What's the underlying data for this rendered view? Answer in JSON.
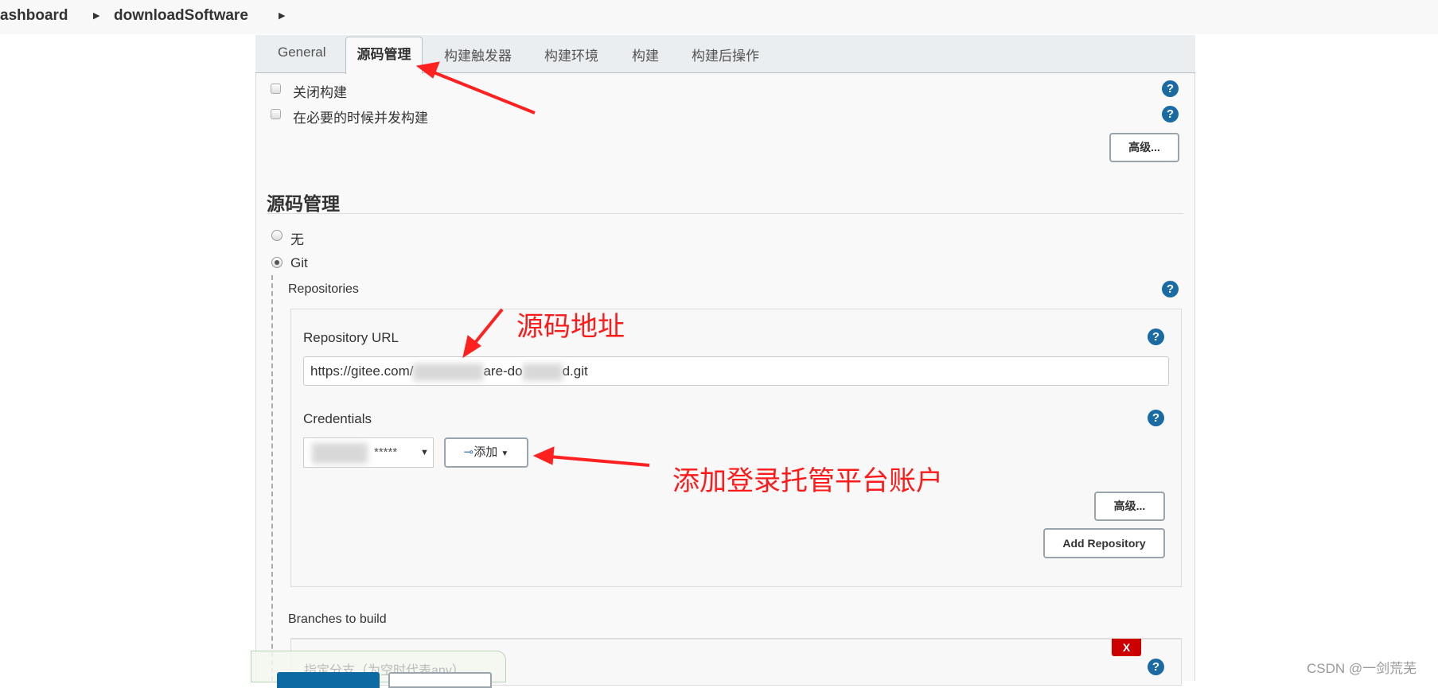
{
  "breadcrumb": {
    "items": [
      "ashboard",
      "downloadSoftware"
    ]
  },
  "tabs": [
    "General",
    "源码管理",
    "构建触发器",
    "构建环境",
    "构建",
    "构建后操作"
  ],
  "active_tab": "源码管理",
  "general": {
    "options": [
      "关闭构建",
      "在必要的时候并发构建"
    ],
    "advanced_label": "高级..."
  },
  "scm": {
    "title": "源码管理",
    "options": [
      {
        "label": "无",
        "selected": false
      },
      {
        "label": "Git",
        "selected": true
      }
    ],
    "repositories_label": "Repositories",
    "repo_url_label": "Repository URL",
    "repo_url_parts": [
      "https://gitee.com/",
      "are-do",
      "d.git"
    ],
    "credentials_label": "Credentials",
    "credentials_value": "*****",
    "add_label": "添加",
    "advanced_label": "高级...",
    "add_repository_label": "Add Repository",
    "branches_label": "Branches to build",
    "branch_placeholder": "指定分支（为空时代表any）",
    "delete_label": "X"
  },
  "annotations": {
    "repo_url": "源码地址",
    "credentials": "添加登录托管平台账户"
  },
  "watermark": "CSDN @一剑荒芜",
  "colors": {
    "accent": "#1a6aa3",
    "annotation": "#ff1a1a",
    "delete": "#cc0000"
  }
}
